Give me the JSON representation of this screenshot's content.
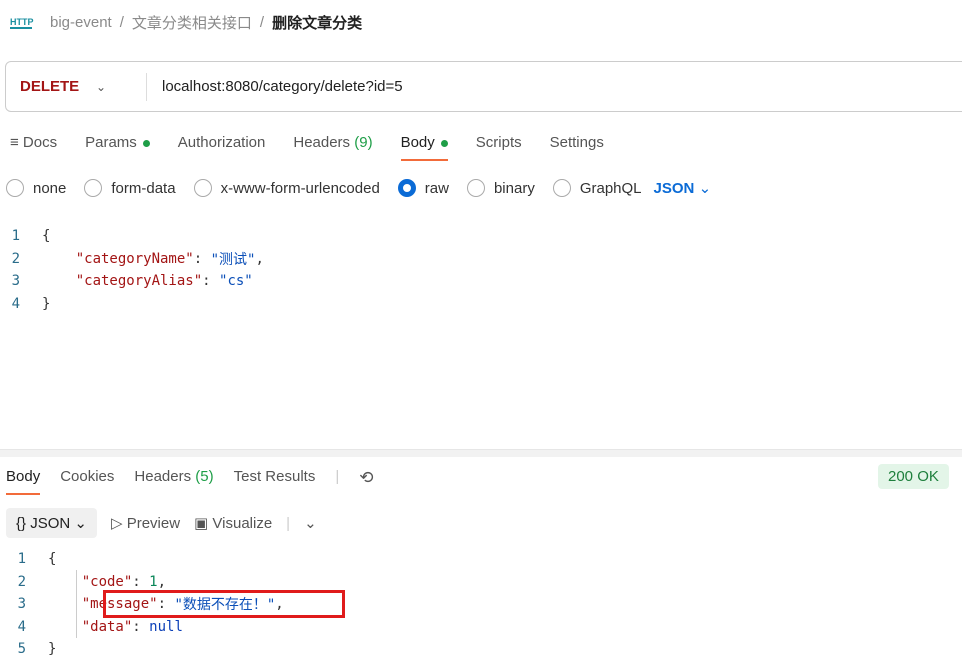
{
  "breadcrumb": {
    "icon": "HTTP",
    "collection": "big-event",
    "folder": "文章分类相关接口",
    "request": "删除文章分类"
  },
  "request": {
    "method": "DELETE",
    "url": "localhost:8080/category/delete?id=5"
  },
  "tabs": {
    "docs": "Docs",
    "params": "Params",
    "authorization": "Authorization",
    "headers": "Headers",
    "headers_count": "(9)",
    "body": "Body",
    "scripts": "Scripts",
    "settings": "Settings"
  },
  "body_types": {
    "none": "none",
    "form_data": "form-data",
    "urlencoded": "x-www-form-urlencoded",
    "raw": "raw",
    "binary": "binary",
    "graphql": "GraphQL",
    "format": "JSON"
  },
  "request_body": [
    {
      "n": "1",
      "open": "{"
    },
    {
      "n": "2",
      "key": "\"categoryName\"",
      "val": "\"测试\"",
      "tail": ","
    },
    {
      "n": "3",
      "key": "\"categoryAlias\"",
      "val": "\"cs\"",
      "tail": ""
    },
    {
      "n": "4",
      "open": "}"
    }
  ],
  "response_tabs": {
    "body": "Body",
    "cookies": "Cookies",
    "headers": "Headers",
    "headers_count": "(5)",
    "tests": "Test Results"
  },
  "status": "200 OK",
  "response_toolbar": {
    "format": "JSON",
    "preview": "Preview",
    "visualize": "Visualize"
  },
  "response_body": {
    "l1": "1",
    "l2": "2",
    "l3": "3",
    "l4": "4",
    "l5": "5",
    "open": "{",
    "close": "}",
    "code_key": "\"code\"",
    "code_val": "1",
    "msg_key": "\"message\"",
    "msg_val": "\"数据不存在！\"",
    "data_key": "\"data\"",
    "data_val": "null"
  }
}
